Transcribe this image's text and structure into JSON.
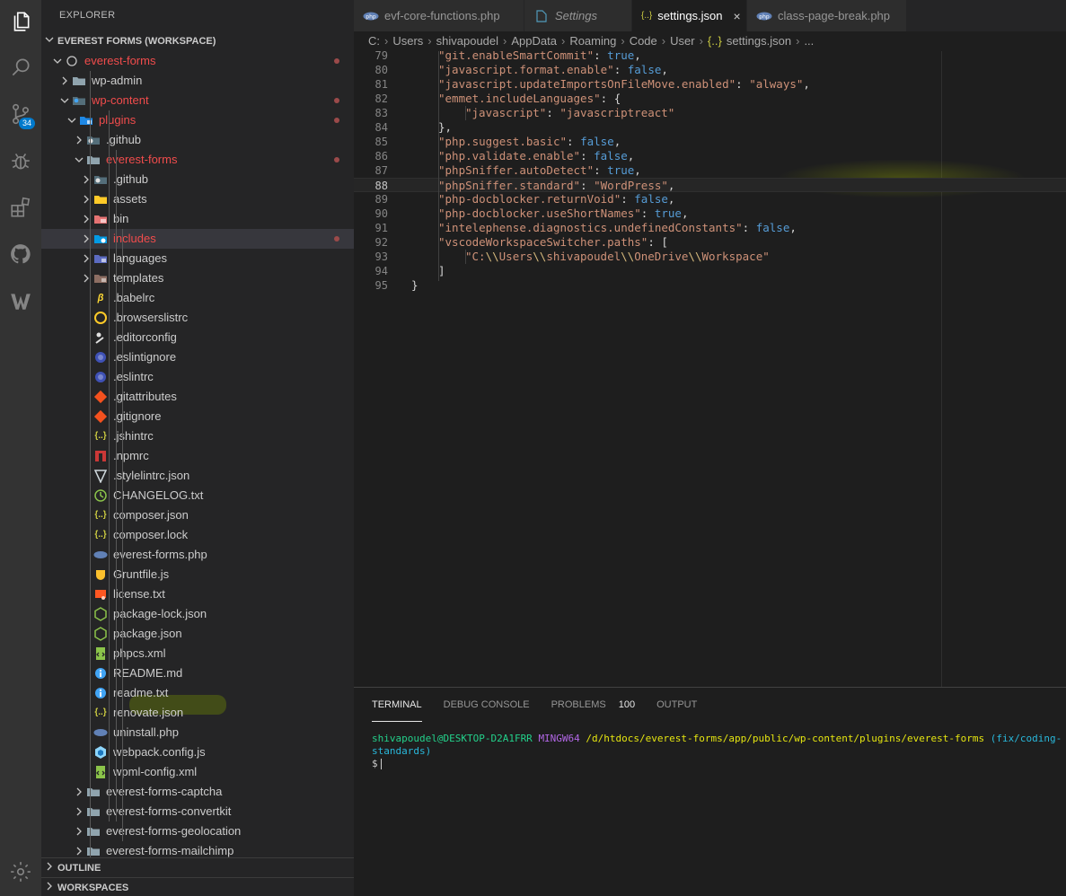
{
  "activity_bar": {
    "items": [
      {
        "name": "explorer-icon",
        "active": true
      },
      {
        "name": "search-icon"
      },
      {
        "name": "source-control-icon",
        "badge": "34"
      },
      {
        "name": "debug-icon"
      },
      {
        "name": "extensions-icon"
      },
      {
        "name": "github-icon"
      },
      {
        "name": "wordpress-icon"
      }
    ],
    "bottom": {
      "name": "gear-icon"
    }
  },
  "sidebar": {
    "title": "EXPLORER",
    "workspace": "EVEREST FORMS (WORKSPACE)",
    "tree": [
      {
        "label": "everest-forms",
        "depth": 1,
        "type": "root",
        "open": true,
        "modified": true
      },
      {
        "label": "wp-admin",
        "depth": 2,
        "type": "folder",
        "open": false
      },
      {
        "label": "wp-content",
        "depth": 2,
        "type": "folder-special",
        "open": true,
        "modified": true
      },
      {
        "label": "plugins",
        "depth": 3,
        "type": "folder-plugins",
        "open": true,
        "modified": true
      },
      {
        "label": ".github",
        "depth": 4,
        "type": "folder-github",
        "open": false
      },
      {
        "label": "everest-forms",
        "depth": 4,
        "type": "folder",
        "open": true,
        "modified": true
      },
      {
        "label": ".github",
        "depth": 5,
        "type": "folder-github",
        "open": false
      },
      {
        "label": "assets",
        "depth": 5,
        "type": "folder-assets",
        "open": false
      },
      {
        "label": "bin",
        "depth": 5,
        "type": "folder-bin",
        "open": false
      },
      {
        "label": "includes",
        "depth": 5,
        "type": "folder-includes",
        "open": false,
        "modified": true,
        "selected": true
      },
      {
        "label": "languages",
        "depth": 5,
        "type": "folder-languages",
        "open": false
      },
      {
        "label": "templates",
        "depth": 5,
        "type": "folder-templates",
        "open": false
      },
      {
        "label": ".babelrc",
        "depth": 5,
        "type": "file-babel"
      },
      {
        "label": ".browserslistrc",
        "depth": 5,
        "type": "file-browserslist"
      },
      {
        "label": ".editorconfig",
        "depth": 5,
        "type": "file-editorconfig"
      },
      {
        "label": ".eslintignore",
        "depth": 5,
        "type": "file-eslint"
      },
      {
        "label": ".eslintrc",
        "depth": 5,
        "type": "file-eslint"
      },
      {
        "label": ".gitattributes",
        "depth": 5,
        "type": "file-git"
      },
      {
        "label": ".gitignore",
        "depth": 5,
        "type": "file-git"
      },
      {
        "label": ".jshintrc",
        "depth": 5,
        "type": "file-json"
      },
      {
        "label": ".npmrc",
        "depth": 5,
        "type": "file-npm"
      },
      {
        "label": ".stylelintrc.json",
        "depth": 5,
        "type": "file-stylelint"
      },
      {
        "label": "CHANGELOG.txt",
        "depth": 5,
        "type": "file-changelog"
      },
      {
        "label": "composer.json",
        "depth": 5,
        "type": "file-json"
      },
      {
        "label": "composer.lock",
        "depth": 5,
        "type": "file-json"
      },
      {
        "label": "everest-forms.php",
        "depth": 5,
        "type": "file-php"
      },
      {
        "label": "Gruntfile.js",
        "depth": 5,
        "type": "file-grunt"
      },
      {
        "label": "license.txt",
        "depth": 5,
        "type": "file-license"
      },
      {
        "label": "package-lock.json",
        "depth": 5,
        "type": "file-node"
      },
      {
        "label": "package.json",
        "depth": 5,
        "type": "file-node"
      },
      {
        "label": "phpcs.xml",
        "depth": 5,
        "type": "file-xml"
      },
      {
        "label": "README.md",
        "depth": 5,
        "type": "file-info"
      },
      {
        "label": "readme.txt",
        "depth": 5,
        "type": "file-info"
      },
      {
        "label": "renovate.json",
        "depth": 5,
        "type": "file-json"
      },
      {
        "label": "uninstall.php",
        "depth": 5,
        "type": "file-php"
      },
      {
        "label": "webpack.config.js",
        "depth": 5,
        "type": "file-webpack"
      },
      {
        "label": "wpml-config.xml",
        "depth": 5,
        "type": "file-xml"
      },
      {
        "label": "everest-forms-captcha",
        "depth": 4,
        "type": "folder",
        "open": false
      },
      {
        "label": "everest-forms-convertkit",
        "depth": 4,
        "type": "folder",
        "open": false
      },
      {
        "label": "everest-forms-geolocation",
        "depth": 4,
        "type": "folder",
        "open": false
      },
      {
        "label": "everest-forms-mailchimp",
        "depth": 4,
        "type": "folder",
        "open": false
      }
    ],
    "outline": "OUTLINE",
    "workspaces": "WORKSPACES"
  },
  "tabs": [
    {
      "label": "evf-core-functions.php",
      "icon": "php-icon"
    },
    {
      "label": "Settings",
      "icon": "file-icon",
      "italic": true
    },
    {
      "label": "settings.json",
      "icon": "json-icon",
      "active": true,
      "close": "×"
    },
    {
      "label": "class-page-break.php",
      "icon": "php-icon"
    }
  ],
  "breadcrumb": [
    "C:",
    "Users",
    "shivapoudel",
    "AppData",
    "Roaming",
    "Code",
    "User",
    "{..}",
    "settings.json",
    "..."
  ],
  "editor": {
    "lines": [
      {
        "n": "79",
        "indent": 1,
        "key": "git.enableSmartCommit",
        "val": "true",
        "vt": "b",
        "end": ","
      },
      {
        "n": "80",
        "indent": 1,
        "key": "javascript.format.enable",
        "val": "false",
        "vt": "b",
        "end": ","
      },
      {
        "n": "81",
        "indent": 1,
        "key": "javascript.updateImportsOnFileMove.enabled",
        "val": "\"always\"",
        "vt": "s",
        "end": ","
      },
      {
        "n": "82",
        "indent": 1,
        "key": "emmet.includeLanguages",
        "val": "{",
        "vt": "p",
        "end": ""
      },
      {
        "n": "83",
        "indent": 2,
        "key": "javascript",
        "val": "\"javascriptreact\"",
        "vt": "s",
        "end": ""
      },
      {
        "n": "84",
        "indent": 1,
        "raw": "},"
      },
      {
        "n": "85",
        "indent": 1,
        "key": "php.suggest.basic",
        "val": "false",
        "vt": "b",
        "end": ","
      },
      {
        "n": "86",
        "indent": 1,
        "key": "php.validate.enable",
        "val": "false",
        "vt": "b",
        "end": ","
      },
      {
        "n": "87",
        "indent": 1,
        "key": "phpSniffer.autoDetect",
        "val": "true",
        "vt": "b",
        "end": ","
      },
      {
        "n": "88",
        "indent": 1,
        "key": "phpSniffer.standard",
        "val": "\"WordPress\"",
        "vt": "s",
        "end": ",",
        "current": true
      },
      {
        "n": "89",
        "indent": 1,
        "key": "php-docblocker.returnVoid",
        "val": "false",
        "vt": "b",
        "end": ","
      },
      {
        "n": "90",
        "indent": 1,
        "key": "php-docblocker.useShortNames",
        "val": "true",
        "vt": "b",
        "end": ","
      },
      {
        "n": "91",
        "indent": 1,
        "key": "intelephense.diagnostics.undefinedConstants",
        "val": "false",
        "vt": "b",
        "end": ","
      },
      {
        "n": "92",
        "indent": 1,
        "key": "vscodeWorkspaceSwitcher.paths",
        "val": "[",
        "vt": "p",
        "end": ""
      },
      {
        "n": "93",
        "indent": 2,
        "path": [
          "\"C:",
          "\\\\",
          "Users",
          "\\\\",
          "shivapoudel",
          "\\\\",
          "OneDrive",
          "\\\\",
          "Workspace\""
        ]
      },
      {
        "n": "94",
        "indent": 1,
        "raw": "]"
      },
      {
        "n": "95",
        "indent": 0,
        "raw": "}"
      }
    ]
  },
  "panel": {
    "tabs": [
      {
        "label": "TERMINAL",
        "active": true
      },
      {
        "label": "DEBUG CONSOLE"
      },
      {
        "label": "PROBLEMS",
        "count": "100"
      },
      {
        "label": "OUTPUT"
      }
    ],
    "terminal": {
      "user": "shivapoudel@DESKTOP-D2A1FRR",
      "env": "MINGW64",
      "path": "/d/htdocs/everest-forms/app/public/wp-content/plugins/everest-forms",
      "branch": "(fix/coding-standards)",
      "prompt": "$"
    }
  },
  "colors": {
    "accent": "#007acc",
    "modified": "#f14c4c",
    "highlight": "#7a9600"
  }
}
